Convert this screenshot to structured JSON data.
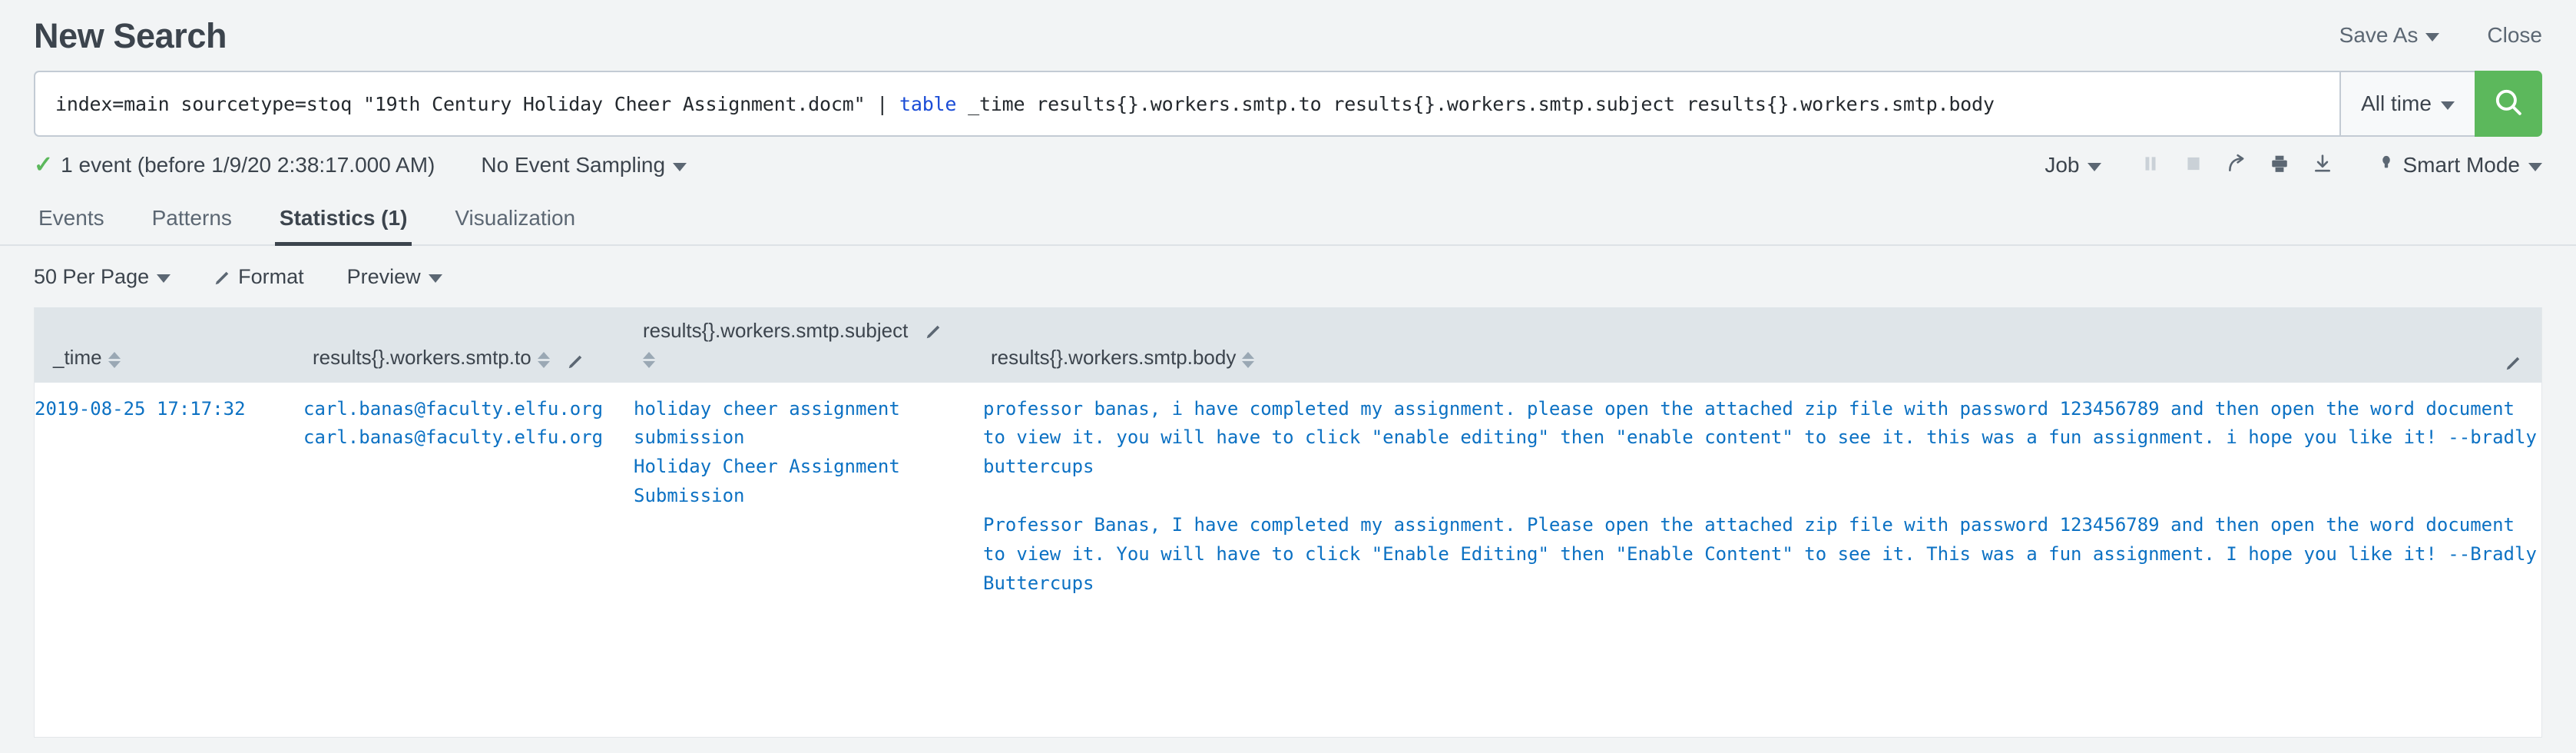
{
  "header": {
    "title": "New Search",
    "save_as_label": "Save As",
    "close_label": "Close"
  },
  "search": {
    "query_prefix": "index=main sourcetype=stoq \"19th Century Holiday Cheer Assignment.docm\" | ",
    "query_command": "table",
    "query_suffix": " _time results{}.workers.smtp.to results{}.workers.smtp.subject results{}.workers.smtp.body",
    "time_range": "All time",
    "search_icon": "search-icon",
    "search_button_color": "#5cb85c"
  },
  "status": {
    "event_count": "1 event (before 1/9/20 2:38:17.000 AM)",
    "check_icon": "check-icon",
    "sampling": "No Event Sampling",
    "job_label": "Job",
    "pause_icon": "pause-icon",
    "stop_icon": "stop-icon",
    "share_icon": "share-icon",
    "print_icon": "print-icon",
    "export_icon": "download-icon",
    "mode_icon": "lightbulb-icon",
    "mode_label": "Smart Mode"
  },
  "tabs": [
    {
      "label": "Events",
      "active": false
    },
    {
      "label": "Patterns",
      "active": false
    },
    {
      "label": "Statistics (1)",
      "active": true
    },
    {
      "label": "Visualization",
      "active": false
    }
  ],
  "results_toolbar": {
    "per_page": "50 Per Page",
    "format_label": "Format",
    "format_icon": "pencil-icon",
    "preview_label": "Preview"
  },
  "table": {
    "columns": [
      {
        "label": "_time",
        "sortable": true,
        "has_pencil": false
      },
      {
        "label": "results{}.workers.smtp.to",
        "sortable": true,
        "has_pencil": true
      },
      {
        "label": "results{}.workers.smtp.subject",
        "sortable": true,
        "has_pencil": true
      },
      {
        "label": "results{}.workers.smtp.body",
        "sortable": true,
        "has_pencil": true
      }
    ],
    "row": {
      "time": "2019-08-25 17:17:32",
      "to": [
        "carl.banas@faculty.elfu.org",
        "carl.banas@faculty.elfu.org"
      ],
      "subject": [
        "holiday cheer assignment submission",
        "Holiday Cheer Assignment Submission"
      ],
      "body": [
        " professor banas, i have completed my assignment. please open the attached zip file with password 123456789 and then open the word document to view it. you will have to click \"enable editing\" then \"enable content\" to see it. this was a fun assignment. i hope you like it!  --bradly buttercups",
        "Professor Banas, I have completed my assignment. Please open the attached zip file with password 123456789 and then open the word document to view it. You will have to click \"Enable Editing\" then \"Enable Content\" to see it. This was a fun assignment. I hope you like it!  --Bradly Buttercups"
      ]
    }
  },
  "colors": {
    "accent_green": "#5cb85c",
    "link_blue": "#0c71c3",
    "command_blue": "#1a4cd6",
    "header_bg": "#dfe5e9",
    "page_bg": "#f2f4f5"
  }
}
